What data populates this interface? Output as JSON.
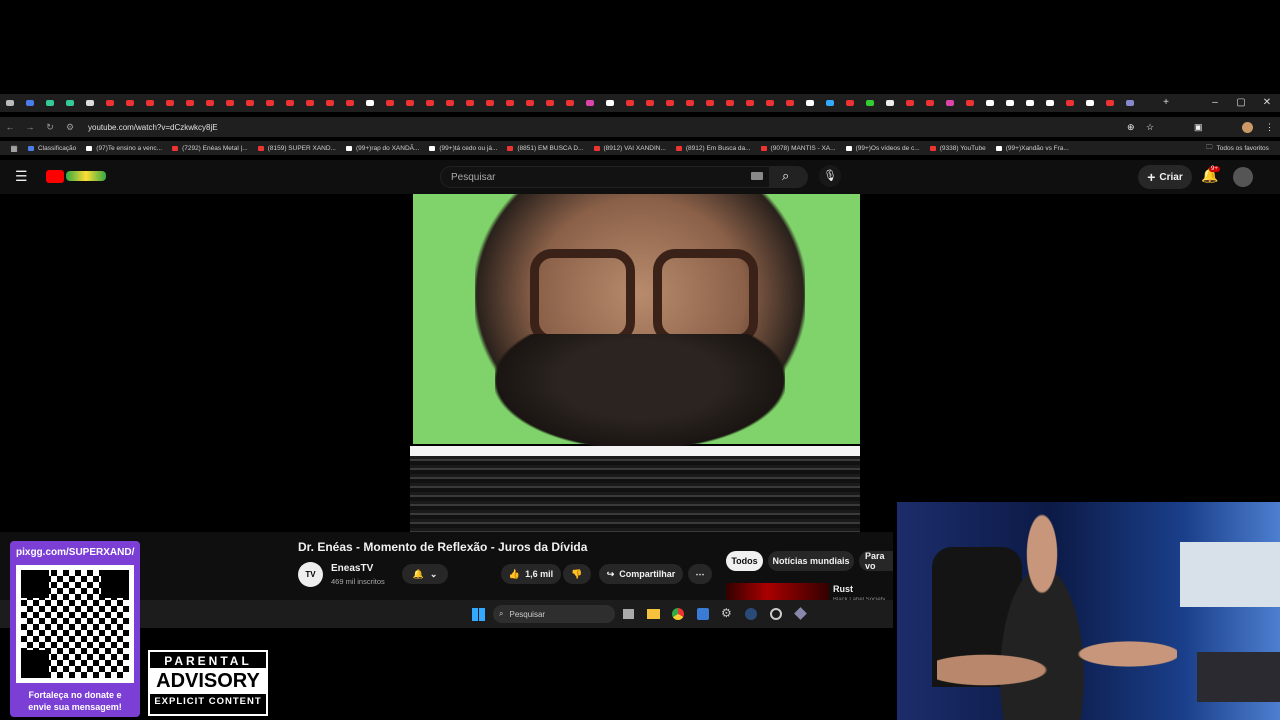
{
  "browser": {
    "url": "youtube.com/watch?v=dCzkwkcy8jE",
    "bookmarks": [
      {
        "label": "Classificação",
        "color": "#4a7de8"
      },
      {
        "label": "(97)Te ensino a venc...",
        "color": "#ffffff"
      },
      {
        "label": "(7292) Enéas Metal |...",
        "color": "#e33"
      },
      {
        "label": "(8159) SUPER XAND...",
        "color": "#e33"
      },
      {
        "label": "(99+)rap do XANDÃ...",
        "color": "#ffffff"
      },
      {
        "label": "(99+)tá cedo ou já...",
        "color": "#ffffff"
      },
      {
        "label": "(8851) EM BUSCA D...",
        "color": "#e33"
      },
      {
        "label": "(8912) VAI XANDIN...",
        "color": "#e33"
      },
      {
        "label": "(8912) Em Busca da...",
        "color": "#e33"
      },
      {
        "label": "(9078) MANTIS - XA...",
        "color": "#e33"
      },
      {
        "label": "(99+)Os vídeos de c...",
        "color": "#ffffff"
      },
      {
        "label": "(9338) YouTube",
        "color": "#e33"
      },
      {
        "label": "(99+)Xandão vs Fra...",
        "color": "#ffffff"
      }
    ],
    "all_bookmarks": "Todos os favoritos"
  },
  "youtube": {
    "search_placeholder": "Pesquisar",
    "create_label": "Criar",
    "notif_badge": "9+",
    "video_title": "Dr. Enéas - Momento de Reflexão - Juros da Dívida",
    "channel_name": "EneasTV",
    "subscribers": "469 mil inscritos",
    "likes": "1,6 mil",
    "share_label": "Compartilhar",
    "chips": [
      "Todos",
      "Notícias mundiais",
      "Para vo"
    ],
    "rec_title": "Rust",
    "rec_sub": "Black Label Society"
  },
  "taskbar": {
    "search_label": "Pesquisar"
  },
  "overlay": {
    "qr_url": "pixgg.com/SUPERXAND/",
    "donate_text_1": "Fortaleça no donate e",
    "donate_text_2": "envie sua mensagem!",
    "advisory_top": "PARENTAL",
    "advisory_mid": "ADVISORY",
    "advisory_bottom": "EXPLICIT CONTENT"
  }
}
